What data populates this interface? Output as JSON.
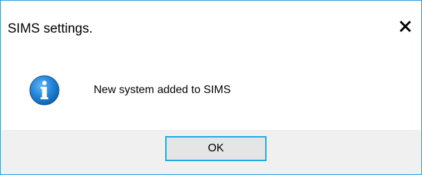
{
  "dialog": {
    "title": "SIMS settings.",
    "message": "New system added to SIMS",
    "ok_label": "OK",
    "icon": "info-icon",
    "close_icon": "close-icon"
  },
  "colors": {
    "border": "#1e9fd6",
    "button_bar": "#f0f0f0",
    "button_face": "#e5e5e5",
    "button_focus_border": "#19a8e0",
    "info_icon_blue": "#1f7fd3"
  }
}
